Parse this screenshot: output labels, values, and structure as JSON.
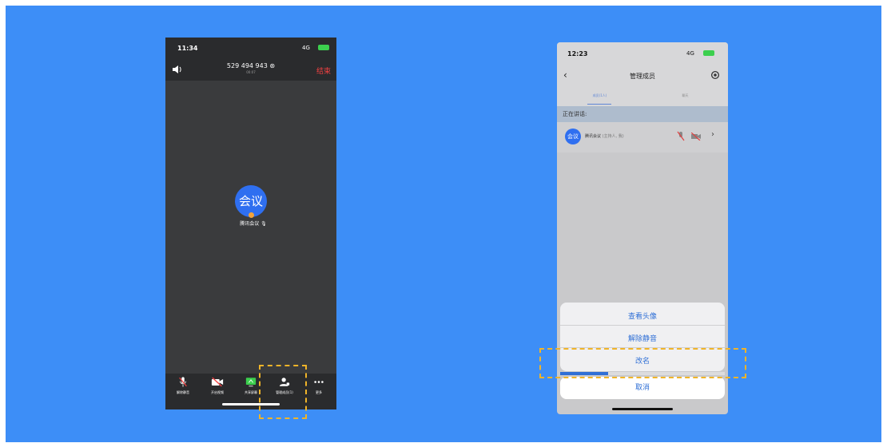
{
  "left_phone": {
    "status": {
      "time": "11:34",
      "signal": "4G",
      "battery": "⚡"
    },
    "header": {
      "meeting_id": "529 494 943",
      "subtitle": "00:07",
      "end_label": "结束"
    },
    "avatar_text": "会议",
    "participant_name": "腾讯会议",
    "toolbar": [
      {
        "label": "解除静音",
        "icon": "mic-off-icon"
      },
      {
        "label": "开启视频",
        "icon": "camera-off-icon"
      },
      {
        "label": "共享屏幕",
        "icon": "share-screen-icon"
      },
      {
        "label": "管理成员(1)",
        "icon": "members-icon"
      },
      {
        "label": "更多",
        "icon": "more-icon"
      }
    ]
  },
  "right_phone": {
    "status": {
      "time": "12:23",
      "signal": "4G"
    },
    "nav": {
      "title": "管理成员"
    },
    "tabs": [
      {
        "label": "成员(1人)",
        "active": true
      },
      {
        "label": "聊天",
        "active": false
      }
    ],
    "section_label": "正在讲话:",
    "member": {
      "avatar_text": "会议",
      "name": "腾讯会议",
      "role": "(主持人, 我)"
    },
    "action_sheet": {
      "options": [
        "查看头像",
        "解除静音",
        "改名"
      ],
      "progress": 0.29,
      "cancel": "取消"
    }
  },
  "colors": {
    "background": "#3d8ef7",
    "accent": "#2f6fd6",
    "highlight": "#f0b429",
    "end": "#f24141"
  }
}
